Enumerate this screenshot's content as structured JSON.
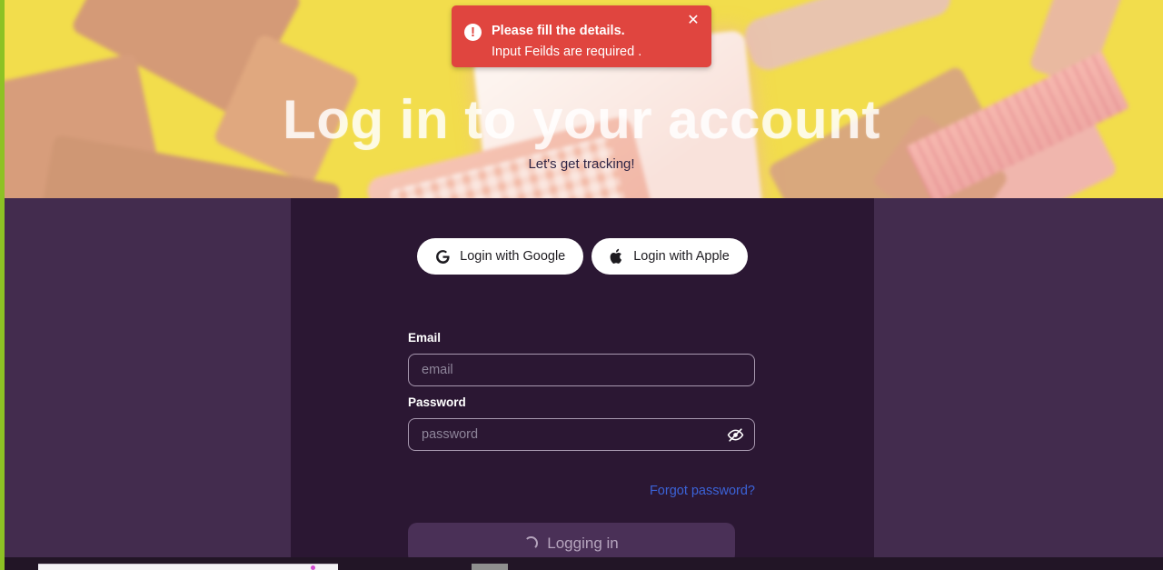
{
  "toast": {
    "icon": "alert-circle-icon",
    "glyph": "!",
    "title": "Please fill the details.",
    "message": "Input Feilds are required .",
    "close_glyph": "✕",
    "bg_color": "#e0453f"
  },
  "hero": {
    "title": "Log in to your account",
    "subtitle": "Let's get tracking!",
    "bg_color": "#f2dd4c"
  },
  "social": {
    "google_label": "Login with Google",
    "apple_label": "Login with Apple"
  },
  "form": {
    "email_label": "Email",
    "email_value": "",
    "email_placeholder": "email",
    "password_label": "Password",
    "password_value": "",
    "password_placeholder": "password",
    "password_toggle_icon": "eye-off-icon",
    "forgot_label": "Forgot password?",
    "forgot_color": "#3b63d8",
    "submit_label": "Logging in",
    "submit_state": "loading"
  },
  "theme": {
    "page_bg": "#432c4e",
    "card_bg": "#2b1733",
    "accent_strip": "#8dc224"
  }
}
